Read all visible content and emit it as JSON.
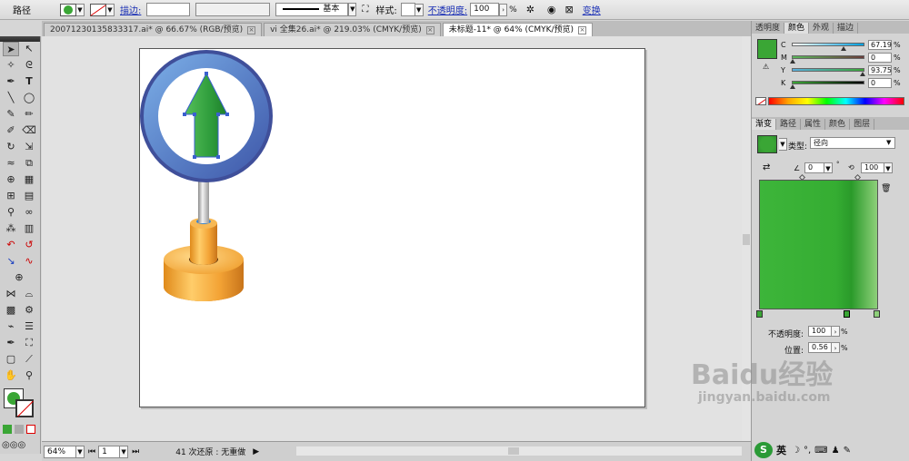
{
  "control_bar": {
    "label": "路径",
    "stroke_label": "描边:",
    "stroke_value": "",
    "brush_label": "基本",
    "style_label": "样式:",
    "opacity_label": "不透明度:",
    "opacity_value": "100",
    "opacity_unit": "%",
    "transform_label": "变换"
  },
  "tabs": [
    {
      "label": "20071230135833317.ai* @ 66.67% (RGB/预览)",
      "active": false
    },
    {
      "label": "vi 全集26.ai* @ 219.03% (CMYK/预览)",
      "active": false
    },
    {
      "label": "未标题-11* @ 64% (CMYK/预览)",
      "active": true
    }
  ],
  "status_bar": {
    "zoom": "64%",
    "artboard": "1",
    "history": "41 次还原 : 无重做"
  },
  "color_panel": {
    "tabs": [
      "透明度",
      "颜色",
      "外观",
      "描边"
    ],
    "active_tab": "颜色",
    "channels": [
      {
        "name": "C",
        "value": "67.19",
        "pos": 0.67
      },
      {
        "name": "M",
        "value": "0",
        "pos": 0.0
      },
      {
        "name": "Y",
        "value": "93.75",
        "pos": 0.94
      },
      {
        "name": "K",
        "value": "0",
        "pos": 0.0
      }
    ],
    "pct": "%"
  },
  "gradient_panel": {
    "tabs": [
      "渐变",
      "路径",
      "属性",
      "颜色",
      "图层"
    ],
    "active_tab": "渐变",
    "type_label": "类型:",
    "type_value": "径向",
    "angle_value": "0",
    "ratio_value": "100",
    "opacity_label": "不透明度:",
    "opacity_value": "100",
    "location_label": "位置:",
    "location_value": "0.56",
    "pct": "%"
  },
  "ime": {
    "mode": "英"
  },
  "watermark": {
    "text": "Baidu经验",
    "url": "jingyan.baidu.com"
  },
  "colors": {
    "fill": "#3aa635",
    "accent_link": "#1a2fb5",
    "sign_ring": "#5a80c8",
    "arrow": "#2e9e3a",
    "base_orange": "#f0a030"
  }
}
